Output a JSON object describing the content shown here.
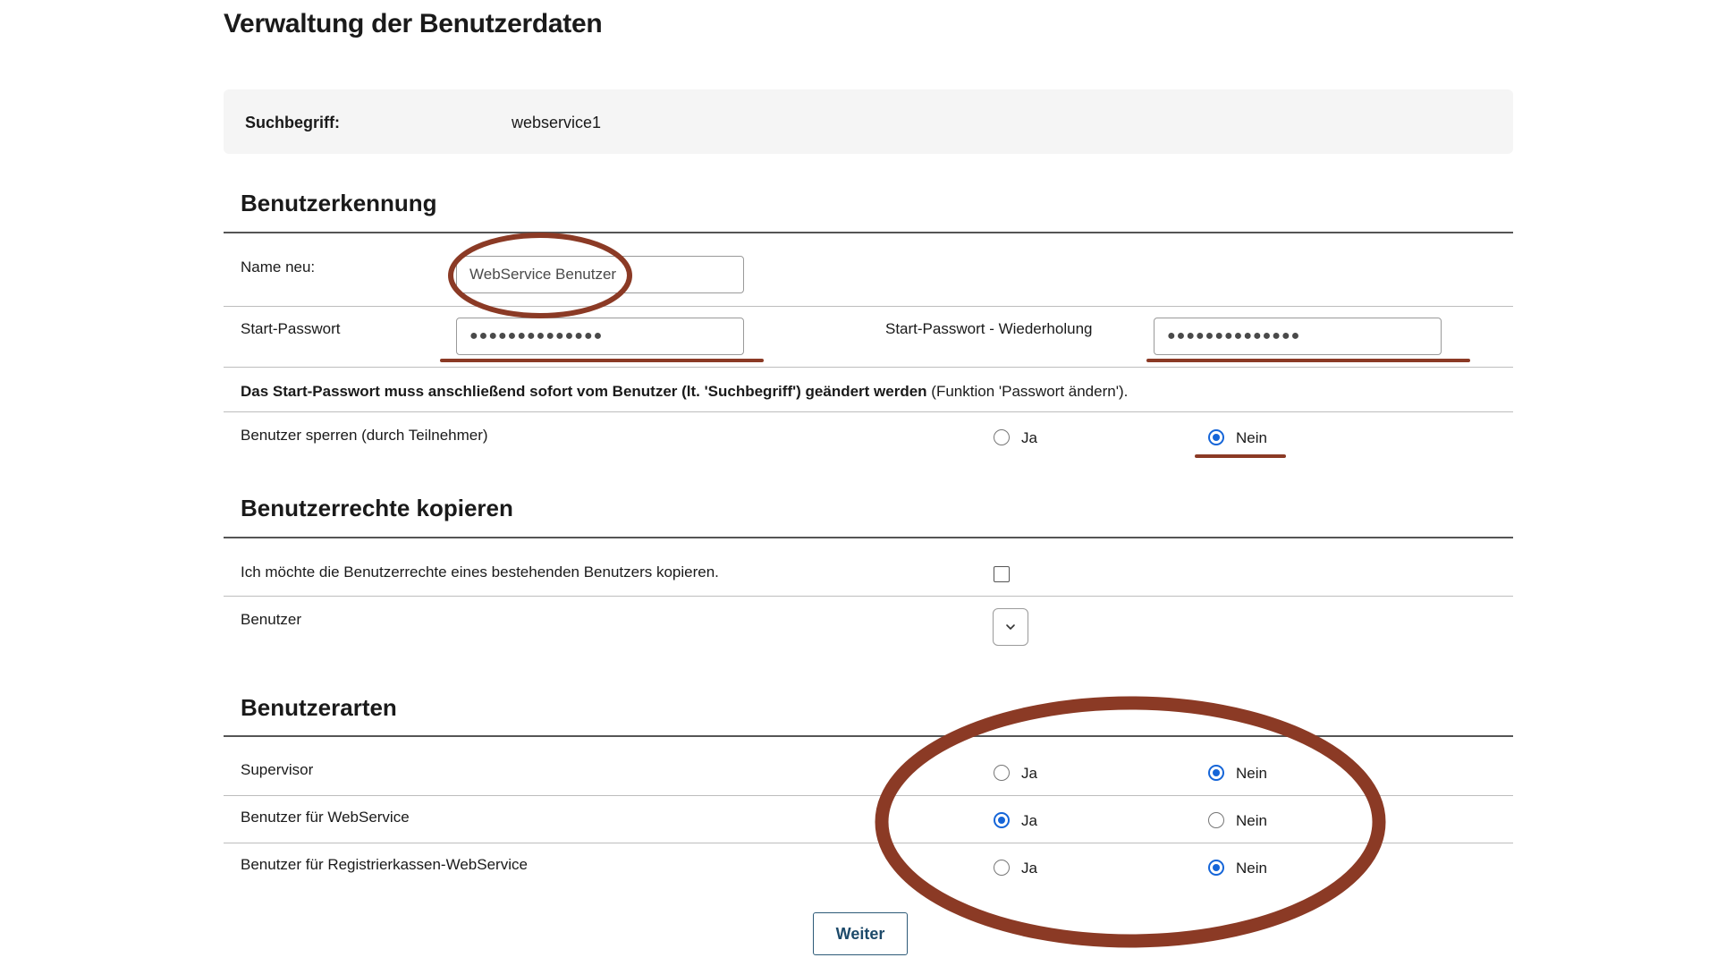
{
  "page": {
    "title": "Verwaltung der Benutzerdaten"
  },
  "search": {
    "label": "Suchbegriff:",
    "value": "webservice1"
  },
  "benutzerkennung": {
    "title": "Benutzerkennung",
    "name_label": "Name neu:",
    "name_value": "WebService Benutzer",
    "password_label": "Start-Passwort",
    "password_value": "●●●●●●●●●●●●●●",
    "password_repeat_label": "Start-Passwort - Wiederholung",
    "password_repeat_value": "●●●●●●●●●●●●●●",
    "note_bold": "Das Start-Passwort muss anschließend sofort vom Benutzer (lt. 'Suchbegriff') geändert werden",
    "note_rest": " (Funktion 'Passwort ändern').",
    "lock_label": "Benutzer sperren (durch Teilnehmer)",
    "lock_yes": "Ja",
    "lock_no": "Nein",
    "lock_selected": "Nein"
  },
  "rechte": {
    "title": "Benutzerrechte kopieren",
    "copy_label": "Ich möchte die Benutzerrechte eines bestehenden Benutzers kopieren.",
    "copy_checked": false,
    "user_label": "Benutzer"
  },
  "arten": {
    "title": "Benutzerarten",
    "rows": [
      {
        "label": "Supervisor",
        "yes": "Ja",
        "no": "Nein",
        "selected": "Nein"
      },
      {
        "label": "Benutzer für WebService",
        "yes": "Ja",
        "no": "Nein",
        "selected": "Ja"
      },
      {
        "label": "Benutzer für Registrierkassen-WebService",
        "yes": "Ja",
        "no": "Nein",
        "selected": "Nein"
      }
    ]
  },
  "actions": {
    "next_label": "Weiter"
  },
  "colors": {
    "annotation": "#8b3a25",
    "radio_selected": "#1565d8",
    "button_text": "#1d4a6a"
  }
}
